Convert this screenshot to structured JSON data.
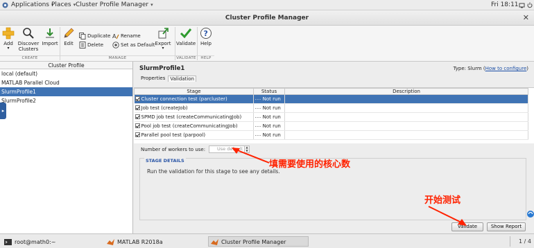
{
  "topbar": {
    "applications": "Applications",
    "places": "Places",
    "app_menu": "Cluster Profile Manager",
    "clock": "Fri 18:11"
  },
  "window": {
    "title": "Cluster Profile Manager"
  },
  "toolstrip": {
    "add": "Add",
    "discover": "Discover",
    "discover2": "Clusters",
    "import": "Import",
    "edit": "Edit",
    "duplicate": "Duplicate",
    "delete": "Delete",
    "rename": "Rename",
    "set_default": "Set as Default",
    "export": "Export",
    "validate": "Validate",
    "help": "Help",
    "sections": {
      "create": "CREATE",
      "manage": "MANAGE",
      "validate": "VALIDATE",
      "help": "HELP"
    }
  },
  "profiles": {
    "header": "Cluster Profile",
    "items": [
      "local (default)",
      "MATLAB Parallel Cloud",
      "SlurmProfile1",
      "SlurmProfile2"
    ],
    "selected_index": 2
  },
  "detail": {
    "profile_title": "SlurmProfile1",
    "type_prefix": "Type: Slurm (",
    "type_link": "How to configure",
    "type_suffix": ")",
    "tabs": [
      "Properties",
      "Validation"
    ],
    "active_tab": "Validation",
    "columns": [
      "Stage",
      "Status",
      "Description"
    ],
    "rows": [
      {
        "stage": "Cluster connection test (parcluster)",
        "status": "Not run",
        "selected": true
      },
      {
        "stage": "Job test (createJob)",
        "status": "Not run"
      },
      {
        "stage": "SPMD job test (createCommunicatingJob)",
        "status": "Not run"
      },
      {
        "stage": "Pool job test (createCommunicatingJob)",
        "status": "Not run"
      },
      {
        "stage": "Parallel pool test (parpool)",
        "status": "Not run"
      }
    ],
    "status_prefix": "---",
    "workers_label": "Number of workers to use:",
    "workers_placeholder": "Use default",
    "stage_details_label": "STAGE DETAILS",
    "stage_details_text": "Run the validation for this stage to see any details.",
    "validate_button": "Validate",
    "show_report_button": "Show Report"
  },
  "annotations": {
    "workers_note": "填需要使用的核心数",
    "start_note": "开始测试",
    "color": "#ff2200"
  },
  "taskbar": {
    "items": [
      "root@math0:~",
      "MATLAB R2018a",
      "Cluster Profile Manager"
    ],
    "active_index": 2,
    "pager": "1 / 4"
  },
  "colors": {
    "selection": "#3f73b4",
    "link": "#1c4fa6",
    "details_label": "#2a55a6"
  },
  "icons": [
    "add-icon",
    "discover-icon",
    "import-icon",
    "edit-icon",
    "duplicate-icon",
    "delete-icon",
    "rename-icon",
    "set-default-icon",
    "export-icon",
    "validate-icon",
    "help-icon",
    "terminal-icon",
    "matlab-icon"
  ]
}
